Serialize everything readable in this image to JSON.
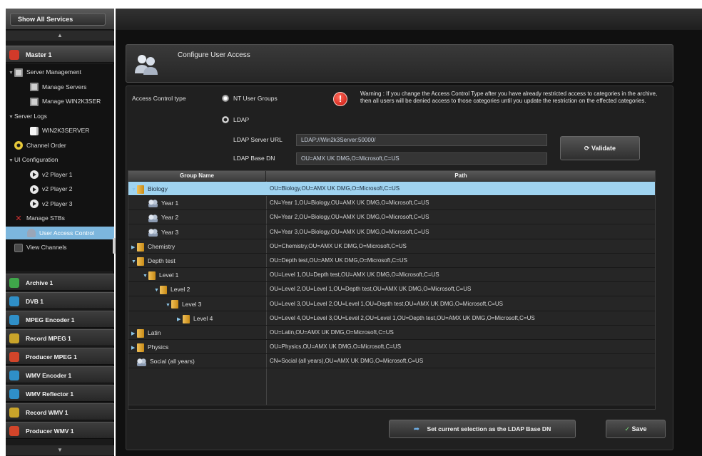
{
  "sidebar": {
    "show_all": "Show All Services",
    "scroll_up": "▲",
    "scroll_down": "▼",
    "master": "Master 1",
    "tree": [
      {
        "label": "Server Management",
        "indent": 0,
        "twisty": "▼",
        "icon": "monitor-icon"
      },
      {
        "label": "Manage Servers",
        "indent": 1,
        "twisty": "",
        "icon": "monitor-icon"
      },
      {
        "label": "Manage WIN2K3SER",
        "indent": 1,
        "twisty": "",
        "icon": "monitor-icon"
      },
      {
        "label": "Server Logs",
        "indent": 0,
        "twisty": "▼",
        "icon": ""
      },
      {
        "label": "WIN2K3SERVER",
        "indent": 1,
        "twisty": "",
        "icon": "file-icon"
      },
      {
        "label": "Channel Order",
        "indent": 0,
        "twisty": "",
        "icon": "gear-icon"
      },
      {
        "label": "UI Configuration",
        "indent": 0,
        "twisty": "▼",
        "icon": ""
      },
      {
        "label": "v2 Player 1",
        "indent": 1,
        "twisty": "",
        "icon": "play-icon"
      },
      {
        "label": "v2 Player 2",
        "indent": 1,
        "twisty": "",
        "icon": "play-icon"
      },
      {
        "label": "v2 Player 3",
        "indent": 1,
        "twisty": "",
        "icon": "play-icon"
      },
      {
        "label": "Manage STBs",
        "indent": 0,
        "twisty": "",
        "icon": "x-icon"
      },
      {
        "label": "User Access Control",
        "indent": 0,
        "twisty": "",
        "icon": "users-icon",
        "selected": true
      },
      {
        "label": "View Channels",
        "indent": 0,
        "twisty": "",
        "icon": "grid-icon"
      }
    ],
    "services": [
      {
        "label": "Archive 1",
        "color": "#3fa64a"
      },
      {
        "label": "DVB 1",
        "color": "#2f8fc8"
      },
      {
        "label": "MPEG Encoder 1",
        "color": "#2f8fc8"
      },
      {
        "label": "Record MPEG 1",
        "color": "#c9a42a"
      },
      {
        "label": "Producer MPEG 1",
        "color": "#d2452a"
      },
      {
        "label": "WMV Encoder 1",
        "color": "#2f8fc8"
      },
      {
        "label": "WMV Reflector 1",
        "color": "#2f8fc8"
      },
      {
        "label": "Record WMV 1",
        "color": "#c9a42a"
      },
      {
        "label": "Producer WMV 1",
        "color": "#d2452a"
      }
    ],
    "master_color": "#d23a2a"
  },
  "page": {
    "title": "Configure User Access",
    "access_control_label": "Access Control type",
    "radio_nt": "NT User Groups",
    "radio_ldap": "LDAP",
    "selected_radio": "ldap",
    "warning": "Warning : If you change the Access Control Type after you have already restricted access to categories in the archive, then all users will be denied access to those categories until you update the restriction on the effected categories.",
    "ldap_url_label": "LDAP Server URL",
    "ldap_url_value": "LDAP://Win2k3Server:50000/",
    "ldap_base_label": "LDAP Base DN",
    "ldap_base_value": "OU=AMX UK DMG,O=Microsoft,C=US",
    "validate": "Validate",
    "set_ldap": "Set current selection as the LDAP Base DN",
    "save": "Save"
  },
  "grid": {
    "columns": [
      "Group Name",
      "Path"
    ],
    "rows": [
      {
        "name": "Biology",
        "path": "OU=Biology,OU=AMX UK DMG,O=Microsoft,C=US",
        "type": "folder",
        "depth": 0,
        "caret": "▼",
        "selected": true
      },
      {
        "name": "Year 1",
        "path": "CN=Year 1,OU=Biology,OU=AMX UK DMG,O=Microsoft,C=US",
        "type": "group",
        "depth": 1,
        "caret": ""
      },
      {
        "name": "Year 2",
        "path": "CN=Year 2,OU=Biology,OU=AMX UK DMG,O=Microsoft,C=US",
        "type": "group",
        "depth": 1,
        "caret": ""
      },
      {
        "name": "Year 3",
        "path": "CN=Year 3,OU=Biology,OU=AMX UK DMG,O=Microsoft,C=US",
        "type": "group",
        "depth": 1,
        "caret": ""
      },
      {
        "name": "Chemistry",
        "path": "OU=Chemistry,OU=AMX UK DMG,O=Microsoft,C=US",
        "type": "folder",
        "depth": 0,
        "caret": "▶"
      },
      {
        "name": "Depth test",
        "path": "OU=Depth test,OU=AMX UK DMG,O=Microsoft,C=US",
        "type": "folder",
        "depth": 0,
        "caret": "▼"
      },
      {
        "name": "Level 1",
        "path": "OU=Level 1,OU=Depth test,OU=AMX UK DMG,O=Microsoft,C=US",
        "type": "folder",
        "depth": 1,
        "caret": "▼"
      },
      {
        "name": "Level 2",
        "path": "OU=Level 2,OU=Level 1,OU=Depth test,OU=AMX UK DMG,O=Microsoft,C=US",
        "type": "folder",
        "depth": 2,
        "caret": "▼"
      },
      {
        "name": "Level 3",
        "path": "OU=Level 3,OU=Level 2,OU=Level 1,OU=Depth test,OU=AMX UK DMG,O=Microsoft,C=US",
        "type": "folder",
        "depth": 3,
        "caret": "▼"
      },
      {
        "name": "Level 4",
        "path": "OU=Level 4,OU=Level 3,OU=Level 2,OU=Level 1,OU=Depth test,OU=AMX UK DMG,O=Microsoft,C=US",
        "type": "folder",
        "depth": 4,
        "caret": "▶"
      },
      {
        "name": "Latin",
        "path": "OU=Latin,OU=AMX UK DMG,O=Microsoft,C=US",
        "type": "folder",
        "depth": 0,
        "caret": "▶"
      },
      {
        "name": "Physics",
        "path": "OU=Physics,OU=AMX UK DMG,O=Microsoft,C=US",
        "type": "folder",
        "depth": 0,
        "caret": "▶"
      },
      {
        "name": "Social (all years)",
        "path": "CN=Social (all years),OU=AMX UK DMG,O=Microsoft,C=US",
        "type": "group",
        "depth": 0,
        "caret": ""
      }
    ]
  }
}
